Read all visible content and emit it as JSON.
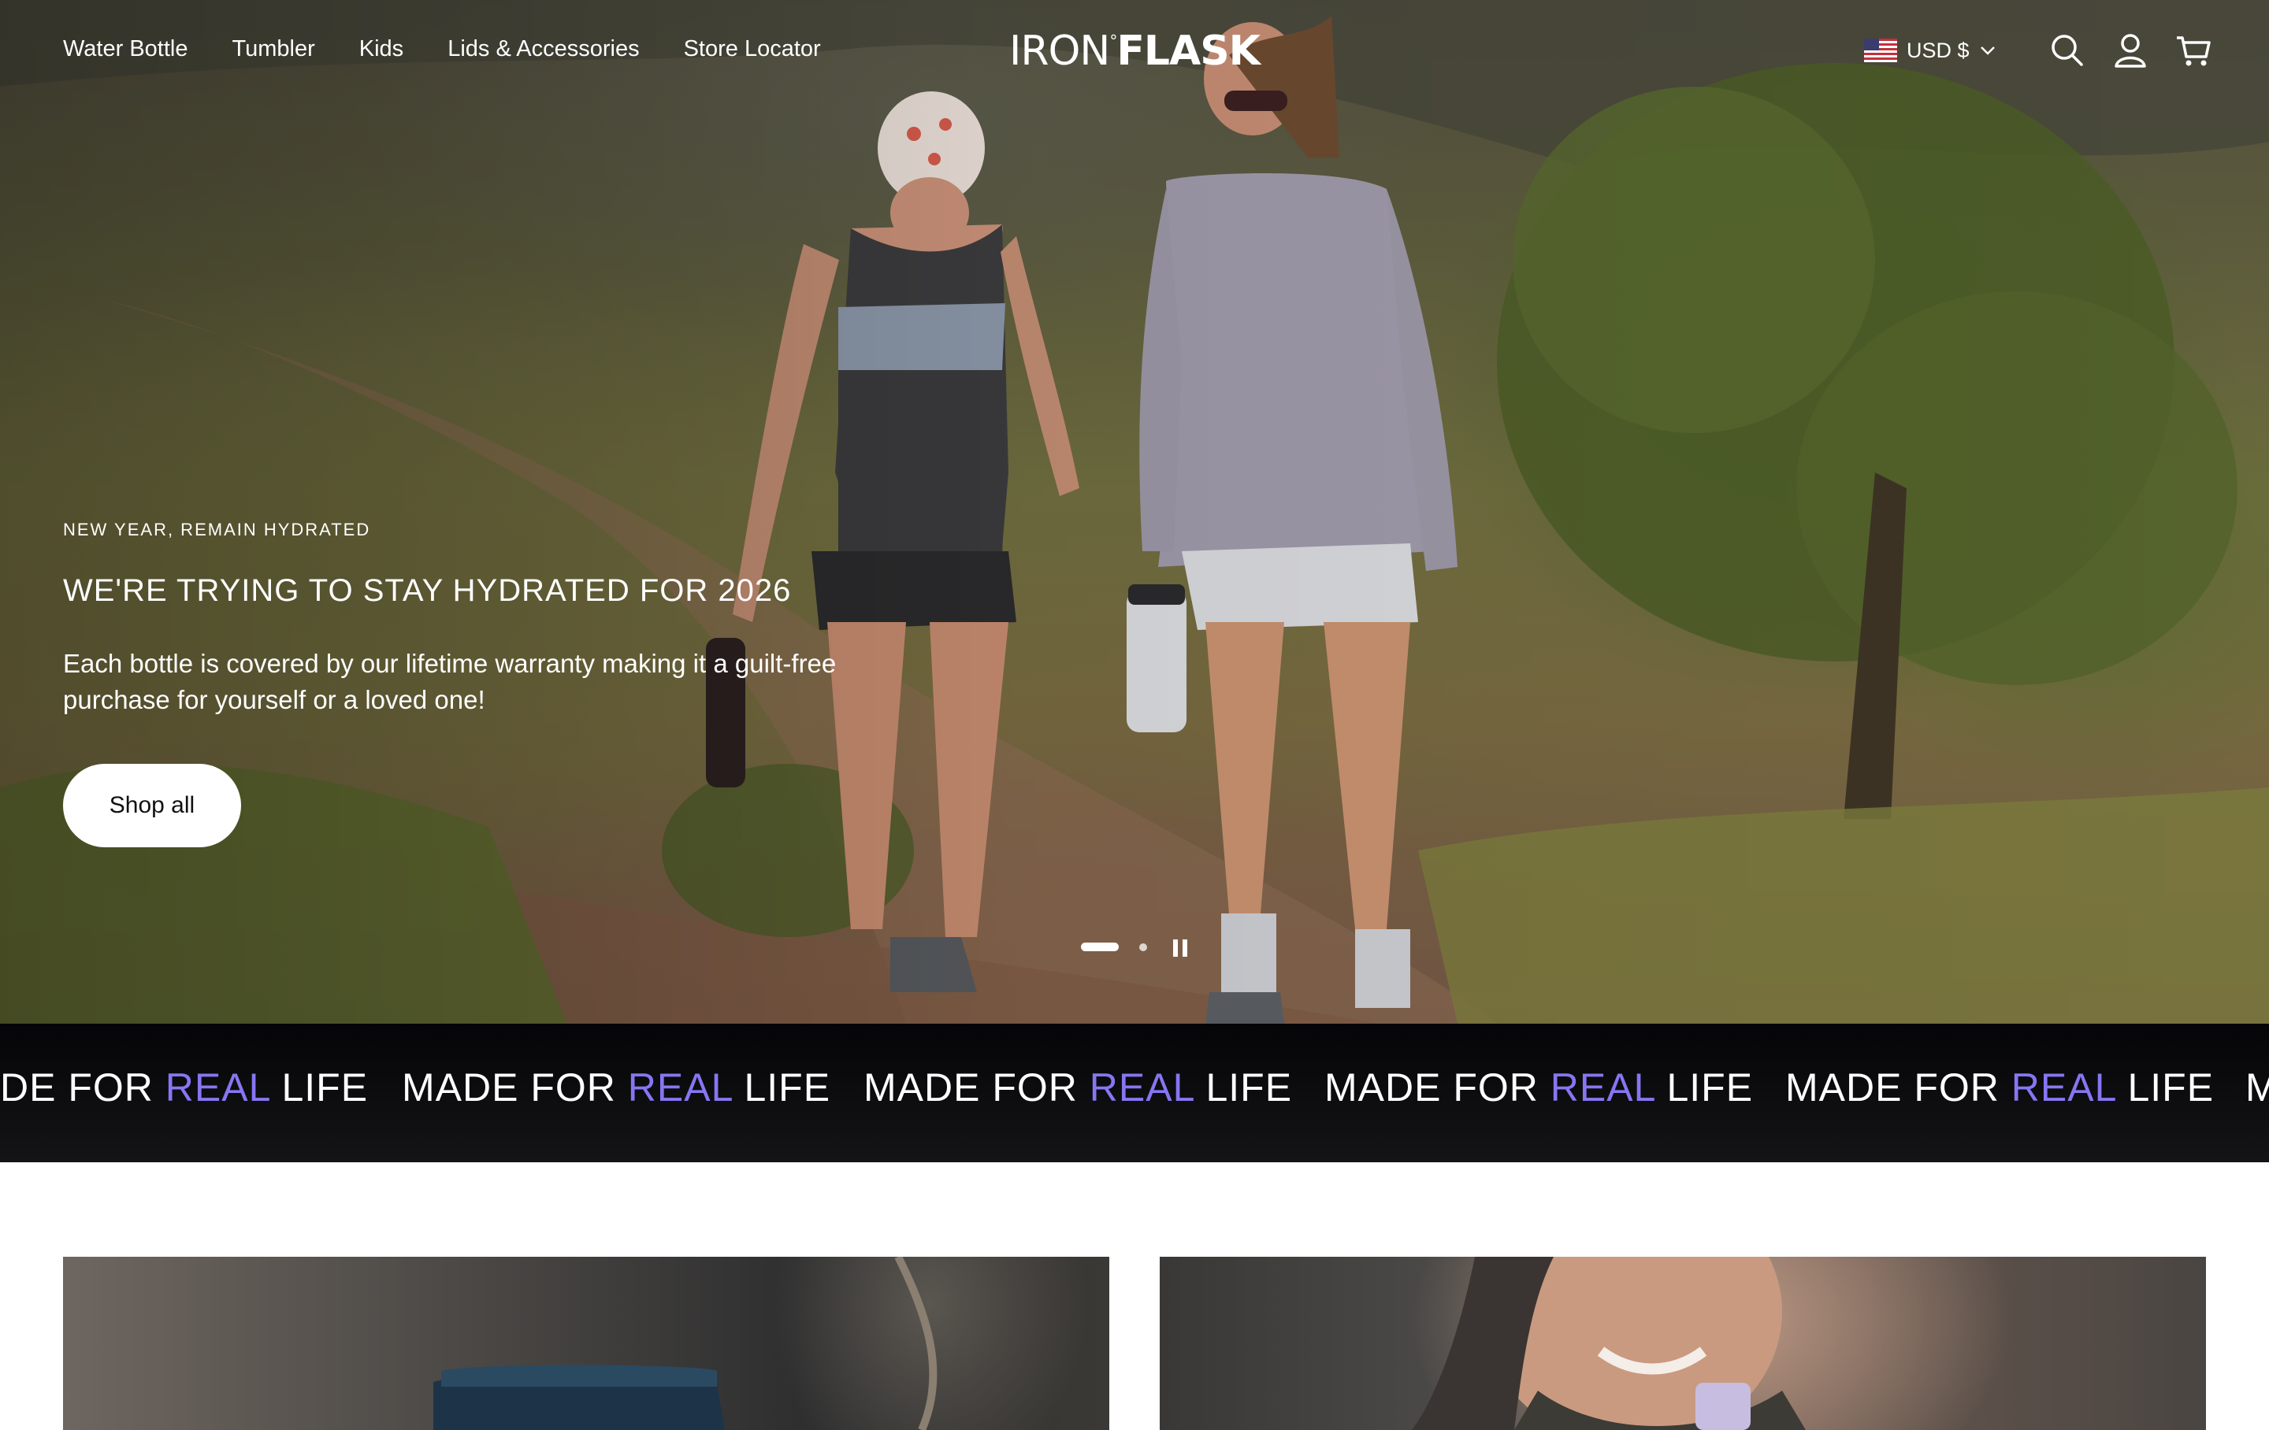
{
  "header": {
    "nav": [
      "Water Bottle",
      "Tumbler",
      "Kids",
      "Lids & Accessories",
      "Store Locator"
    ],
    "logo": {
      "part1": "IRON",
      "part2": "FLASK"
    },
    "currency": "USD $",
    "icons": [
      "search-icon",
      "account-icon",
      "cart-icon"
    ]
  },
  "hero": {
    "eyebrow": "NEW YEAR, REMAIN HYDRATED",
    "title": "WE'RE TRYING TO STAY HYDRATED FOR 2026",
    "body": "Each bottle is covered by our lifetime warranty making it a guilt-free purchase for yourself or a loved one!",
    "cta": "Shop all",
    "slides": {
      "count": 2,
      "active": 1,
      "state": "playing"
    }
  },
  "marquee": {
    "prefix": "MADE FOR ",
    "accent": "REAL",
    "suffix": " LIFE",
    "partial_start": "DE FOR ",
    "partial_end": "M",
    "accent_color": "#8676f2"
  },
  "colors": {
    "marquee_bg": "#0b0b0d",
    "button_bg": "#ffffff",
    "accent": "#8676f2"
  }
}
